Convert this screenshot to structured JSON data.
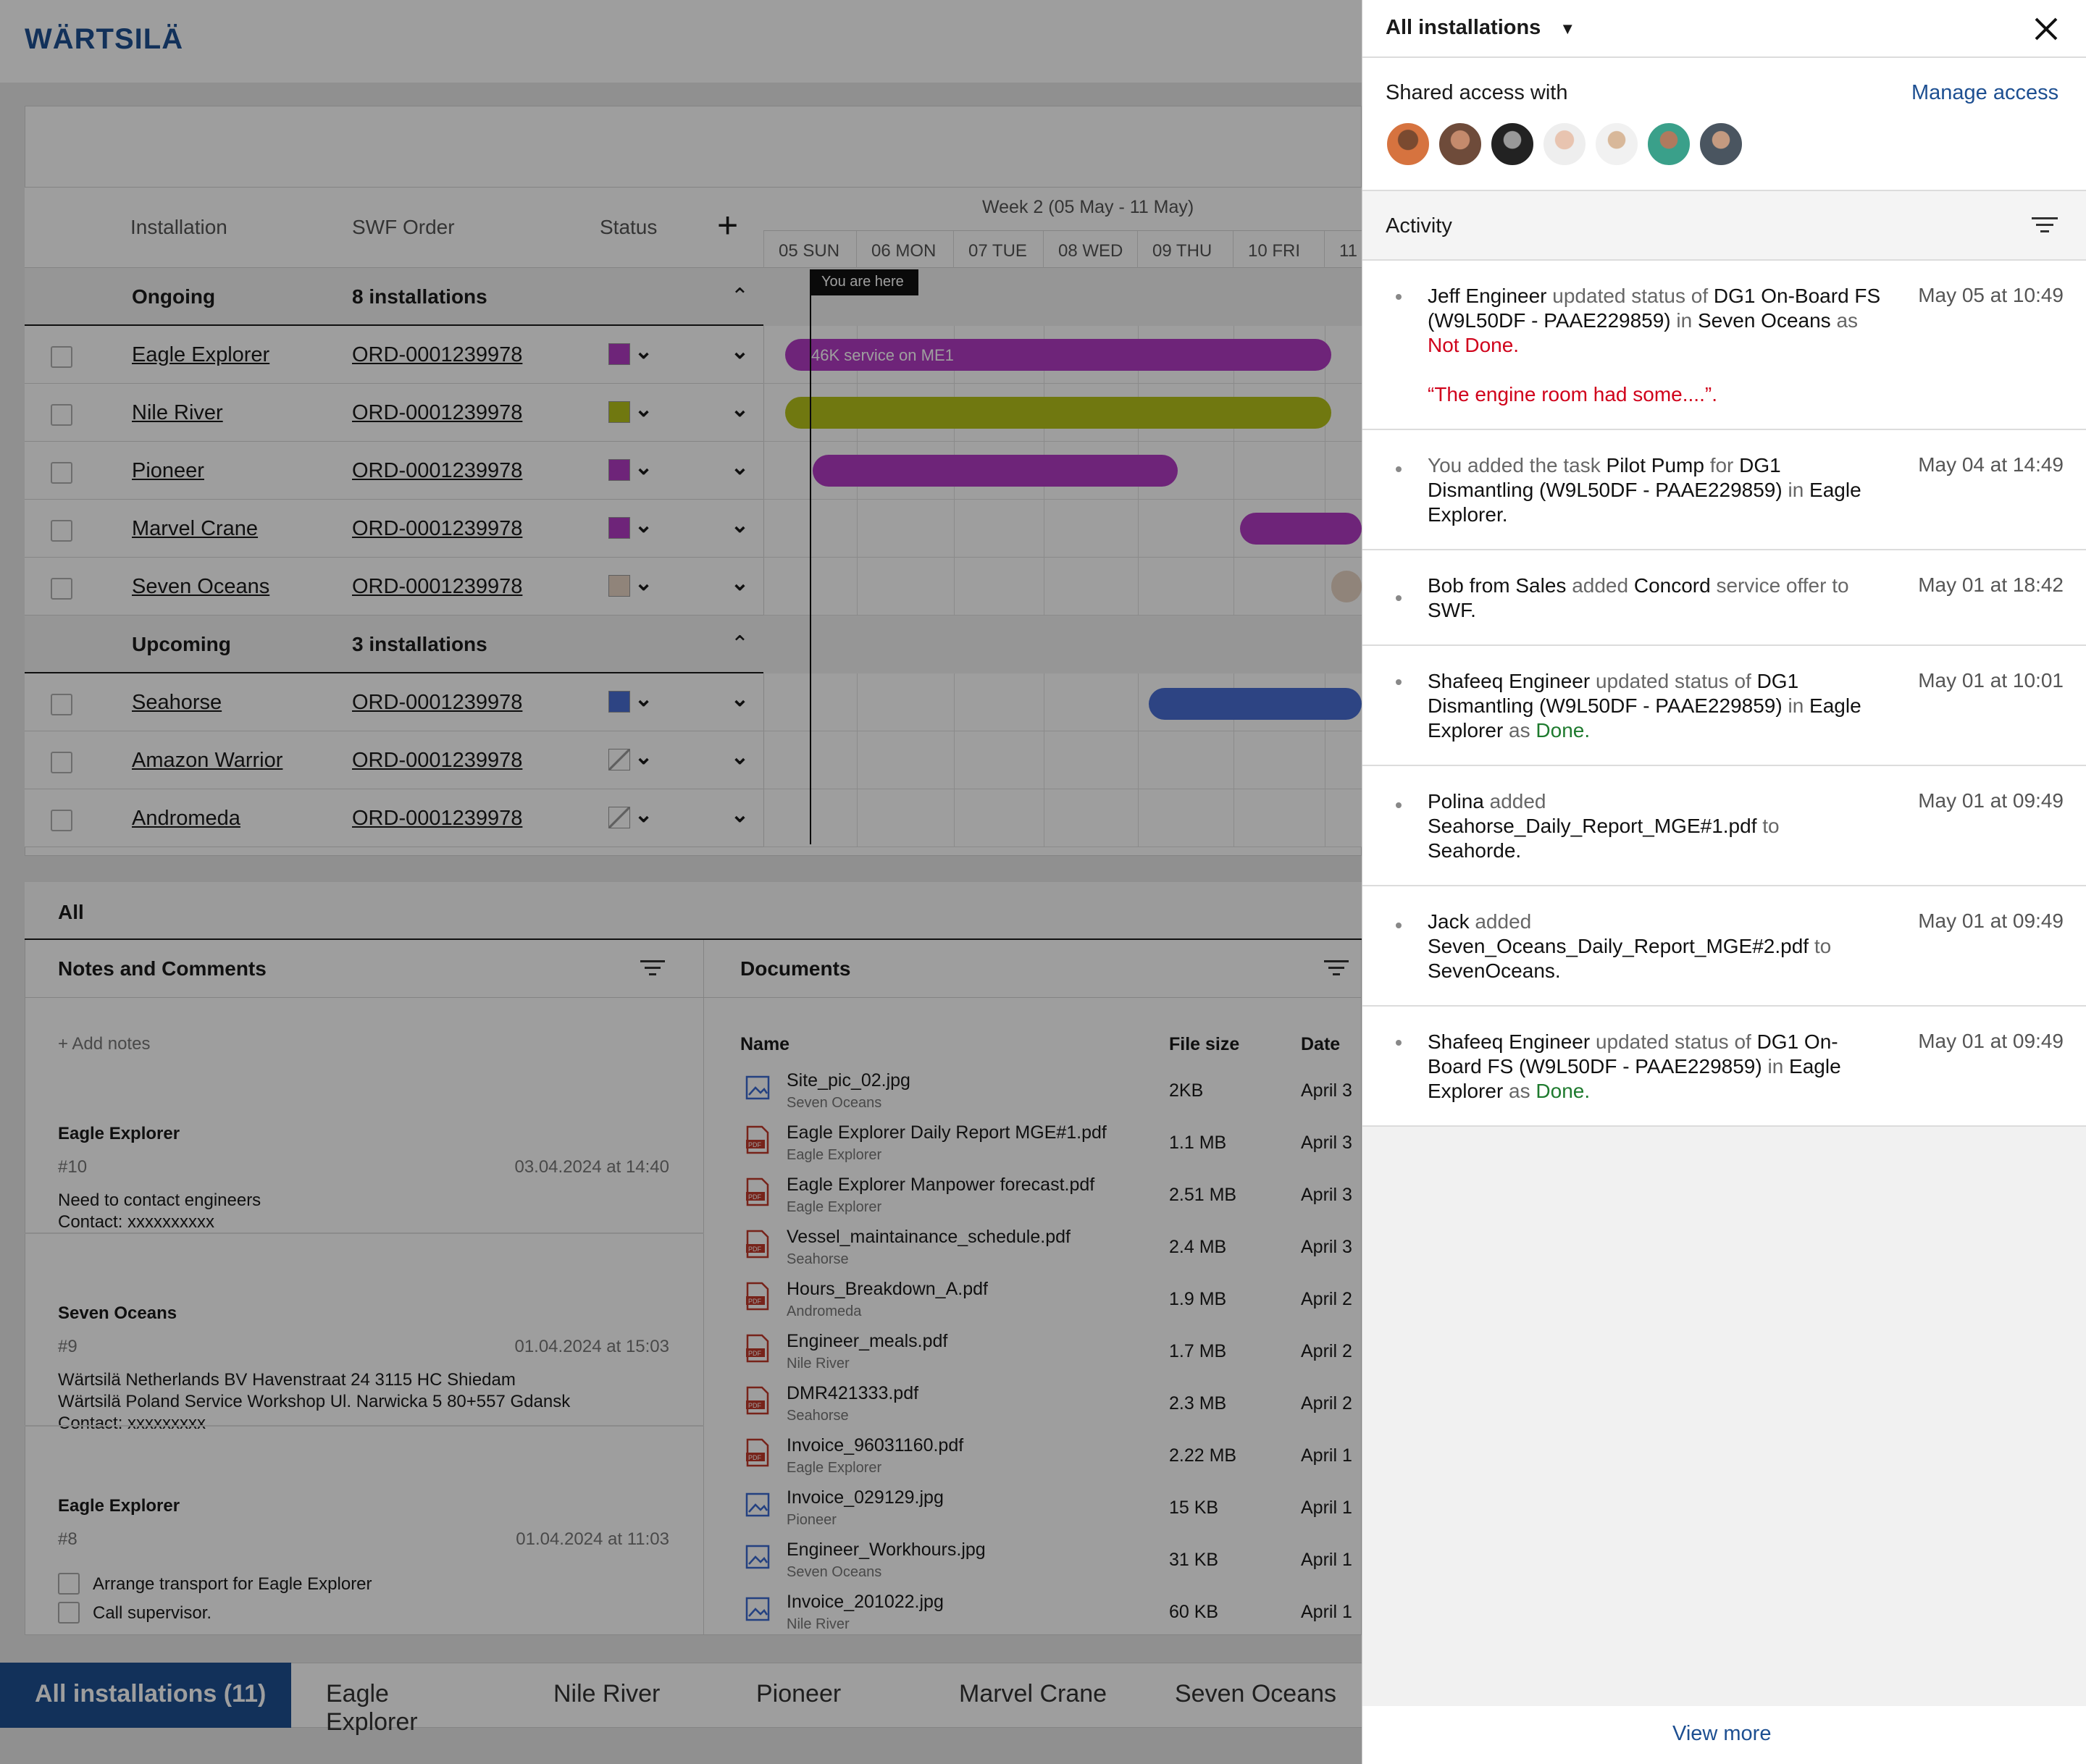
{
  "brand": "WÄRTSILÄ",
  "table": {
    "headers": {
      "installation": "Installation",
      "swf_order": "SWF Order",
      "status": "Status"
    },
    "week_label": "Week 2 (05 May - 11 May)",
    "days": [
      "05 SUN",
      "06 MON",
      "07 TUE",
      "08 WED",
      "09 THU",
      "10 FRI",
      "11"
    ],
    "you_are_here": "You are here",
    "groups": [
      {
        "title": "Ongoing",
        "count": "8 installations"
      },
      {
        "title": "Upcoming",
        "count": "3 installations"
      }
    ],
    "rows": [
      {
        "name": "Eagle Explorer",
        "order": "ORD-0001239978",
        "color": "#b23bc4"
      },
      {
        "name": "Nile River",
        "order": "ORD-0001239978",
        "color": "#b5c21b"
      },
      {
        "name": "Pioneer",
        "order": "ORD-0001239978",
        "color": "#b23bc4"
      },
      {
        "name": "Marvel Crane",
        "order": "ORD-0001239978",
        "color": "#b23bc4"
      },
      {
        "name": "Seven Oceans",
        "order": "ORD-0001239978",
        "color": "#e9d6c6"
      },
      {
        "name": "Seahorse",
        "order": "ORD-0001239978",
        "color": "#4a6ed4"
      },
      {
        "name": "Amazon Warrior",
        "order": "ORD-0001239978",
        "color": "none"
      },
      {
        "name": "Andromeda",
        "order": "ORD-0001239978",
        "color": "none"
      }
    ],
    "bar_label": "46K service on ME1"
  },
  "bottom": {
    "all_label": "All",
    "notes_title": "Notes and Comments",
    "add_notes": "+ Add notes",
    "notes": [
      {
        "title": "Eagle Explorer",
        "num": "#10",
        "date": "03.04.2024 at 14:40",
        "lines": [
          "Need to contact engineers",
          "Contact: xxxxxxxxxx"
        ]
      },
      {
        "title": "Seven Oceans",
        "num": "#9",
        "date": "01.04.2024 at 15:03",
        "lines": [
          "Wärtsilä Netherlands BV Havenstraat 24 3115 HC Shiedam",
          "Wärtsilä Poland Service Workshop Ul. Narwicka 5 80+557 Gdansk",
          "Contact: xxxxxxxxx"
        ]
      },
      {
        "title": "Eagle Explorer",
        "num": "#8",
        "date": "01.04.2024 at 11:03",
        "checks": [
          "Arrange transport for Eagle Explorer",
          "Call supervisor."
        ]
      }
    ],
    "docs_title": "Documents",
    "doc_headers": {
      "name": "Name",
      "size": "File size",
      "date": "Date"
    },
    "docs": [
      {
        "name": "Site_pic_02.jpg",
        "sub": "Seven Oceans",
        "size": "2KB",
        "date": "April 3",
        "type": "img"
      },
      {
        "name": "Eagle Explorer Daily Report MGE#1.pdf",
        "sub": "Eagle Explorer",
        "size": "1.1 MB",
        "date": "April 3",
        "type": "pdf"
      },
      {
        "name": "Eagle Explorer Manpower forecast.pdf",
        "sub": "Eagle Explorer",
        "size": "2.51 MB",
        "date": "April 3",
        "type": "pdf"
      },
      {
        "name": "Vessel_maintainance_schedule.pdf",
        "sub": "Seahorse",
        "size": "2.4 MB",
        "date": "April 3",
        "type": "pdf"
      },
      {
        "name": "Hours_Breakdown_A.pdf",
        "sub": "Andromeda",
        "size": "1.9 MB",
        "date": "April 2",
        "type": "pdf"
      },
      {
        "name": "Engineer_meals.pdf",
        "sub": "Nile River",
        "size": "1.7 MB",
        "date": "April 2",
        "type": "pdf"
      },
      {
        "name": "DMR421333.pdf",
        "sub": "Seahorse",
        "size": "2.3 MB",
        "date": "April 2",
        "type": "pdf"
      },
      {
        "name": "Invoice_96031160.pdf",
        "sub": "Eagle Explorer",
        "size": "2.22 MB",
        "date": "April 1",
        "type": "pdf"
      },
      {
        "name": "Invoice_029129.jpg",
        "sub": "Pioneer",
        "size": "15 KB",
        "date": "April 1",
        "type": "img"
      },
      {
        "name": "Engineer_Workhours.jpg",
        "sub": "Seven Oceans",
        "size": "31 KB",
        "date": "April 1",
        "type": "img"
      },
      {
        "name": "Invoice_201022.jpg",
        "sub": "Nile River",
        "size": "60 KB",
        "date": "April 1",
        "type": "img"
      }
    ]
  },
  "tabs": [
    "All installations (11)",
    "Eagle Explorer",
    "Nile River",
    "Pioneer",
    "Marvel Crane",
    "Seven Oceans"
  ],
  "panel": {
    "dropdown": "All installations",
    "shared_label": "Shared access with",
    "manage": "Manage access",
    "activity_title": "Activity",
    "view_more": "View more",
    "items": [
      {
        "time": "May 05 at 10:49"
      },
      {
        "time": "May 04 at 14:49"
      },
      {
        "time": "May 01 at 18:42"
      },
      {
        "time": "May 01 at 10:01"
      },
      {
        "time": "May 01 at 09:49"
      },
      {
        "time": "May 01 at 09:49"
      },
      {
        "time": "May 01 at 09:49"
      }
    ],
    "t": {
      "a1": "Jeff Engineer",
      "a2": " updated status of ",
      "a3": "DG1 On-Board FS (W9L50DF - PAAE229859)",
      "a4": " in ",
      "a5": "Seven Oceans",
      "a6": " as ",
      "a7": "Not Done.",
      "a8": "“The engine room had some....”.",
      "b1": "You added the task ",
      "b2": "Pilot Pump",
      "b3": " for ",
      "b4": "DG1 Dismantling (W9L50DF - PAAE229859)",
      "b5": " in ",
      "b6": "Eagle Explorer.",
      "c1": "Bob from Sales",
      "c2": " added ",
      "c3": "Concord",
      "c4": " service offer to ",
      "c5": "SWF.",
      "d1": "Shafeeq Engineer",
      "d2": " updated status of ",
      "d3": "DG1 Dismantling (W9L50DF - PAAE229859)",
      "d4": " in ",
      "d5": "Eagle Explorer",
      "d6": " as ",
      "d7": "Done.",
      "e1": "Polina",
      "e2": " added ",
      "e3": "Seahorse_Daily_Report_MGE#1.pdf",
      "e4": " to ",
      "e5": "Seahorde.",
      "f1": "Jack",
      "f2": " added ",
      "f3": "Seven_Oceans_Daily_Report_MGE#2.pdf",
      "f4": " to ",
      "f5": "SevenOceans.",
      "g1": "Shafeeq Engineer",
      "g2": " updated status of ",
      "g3": "DG1 On-Board FS (W9L50DF - PAAE229859)",
      "g4": " in ",
      "g5": "Eagle Explorer",
      "g6": " as ",
      "g7": "Done."
    }
  }
}
